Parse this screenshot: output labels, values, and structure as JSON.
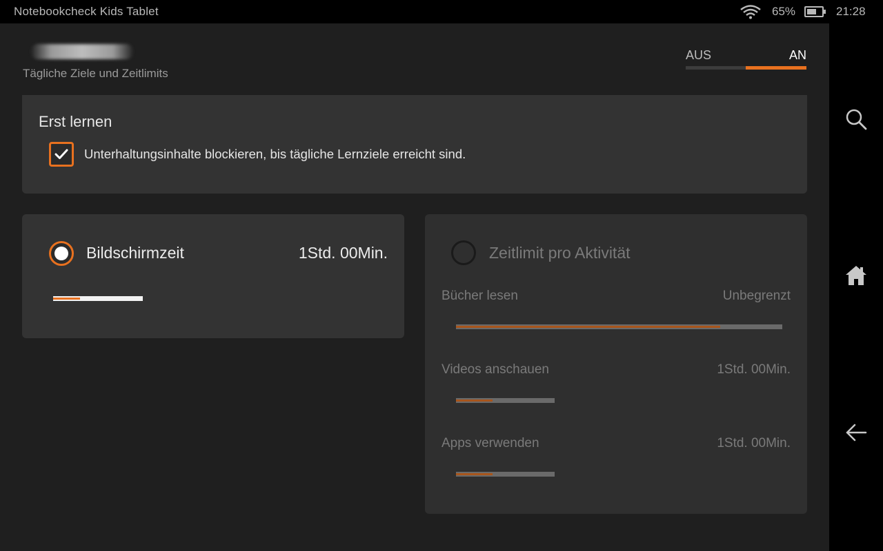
{
  "status": {
    "title": "Notebookcheck Kids Tablet",
    "battery": "65%",
    "battery_level": 0.65,
    "time": "21:28"
  },
  "header": {
    "subtitle": "Tägliche Ziele und Zeitlimits"
  },
  "toggle": {
    "off_label": "AUS",
    "on_label": "AN",
    "state": "AN"
  },
  "learn_first": {
    "title": "Erst lernen",
    "checkbox_label": "Unterhaltungsinhalte blockieren, bis tägliche Lernziele erreicht sind.",
    "checked": true
  },
  "screen_time": {
    "label": "Bildschirmzeit",
    "value": "1Std. 00Min.",
    "selected": true,
    "slider_fraction": 0.3
  },
  "activity_limit": {
    "label": "Zeitlimit pro Aktivität",
    "selected": false,
    "items": [
      {
        "label": "Bücher lesen",
        "value": "Unbegrenzt",
        "slider_fraction": 0.81
      },
      {
        "label": "Videos anschauen",
        "value": "1Std. 00Min.",
        "slider_fraction": 0.37
      },
      {
        "label": "Apps verwenden",
        "value": "1Std. 00Min.",
        "slider_fraction": 0.37
      }
    ]
  },
  "colors": {
    "accent": "#e8711f",
    "background": "#1f1f1f",
    "card": "#333333"
  },
  "nav": {
    "icons": [
      "search-icon",
      "home-icon",
      "back-icon"
    ]
  }
}
